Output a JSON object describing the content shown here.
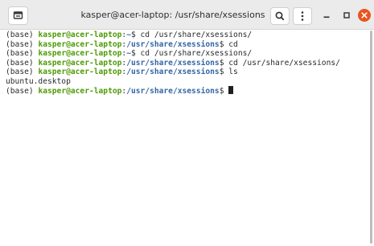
{
  "window": {
    "title": "kasper@acer-laptop: /usr/share/xsessions"
  },
  "colors": {
    "titlebar": "#ebebeb",
    "user_host": "#4e9a06",
    "path": "#3465a4",
    "close": "#e95420"
  },
  "icons": {
    "new_tab": "new-tab-icon",
    "search": "search-icon",
    "menu": "kebab-menu-icon",
    "minimize": "minimize-icon",
    "maximize": "maximize-icon",
    "close": "close-icon"
  },
  "terminal": {
    "lines": [
      {
        "env": "(base) ",
        "user": "kasper@acer-laptop",
        "sep": ":",
        "path": "~",
        "suffix": "$ cd /usr/share/xsessions/"
      },
      {
        "env": "(base) ",
        "user": "kasper@acer-laptop",
        "sep": ":",
        "path": "/usr/share/xsessions",
        "suffix": "$ cd"
      },
      {
        "env": "(base) ",
        "user": "kasper@acer-laptop",
        "sep": ":",
        "path": "~",
        "suffix": "$ cd /usr/share/xsessions/"
      },
      {
        "env": "(base) ",
        "user": "kasper@acer-laptop",
        "sep": ":",
        "path": "/usr/share/xsessions",
        "suffix": "$ cd /usr/share/xsessions/"
      },
      {
        "env": "(base) ",
        "user": "kasper@acer-laptop",
        "sep": ":",
        "path": "/usr/share/xsessions",
        "suffix": "$ ls"
      },
      {
        "output": "ubuntu.desktop"
      },
      {
        "env": "(base) ",
        "user": "kasper@acer-laptop",
        "sep": ":",
        "path": "/usr/share/xsessions",
        "suffix": "$ "
      }
    ]
  }
}
